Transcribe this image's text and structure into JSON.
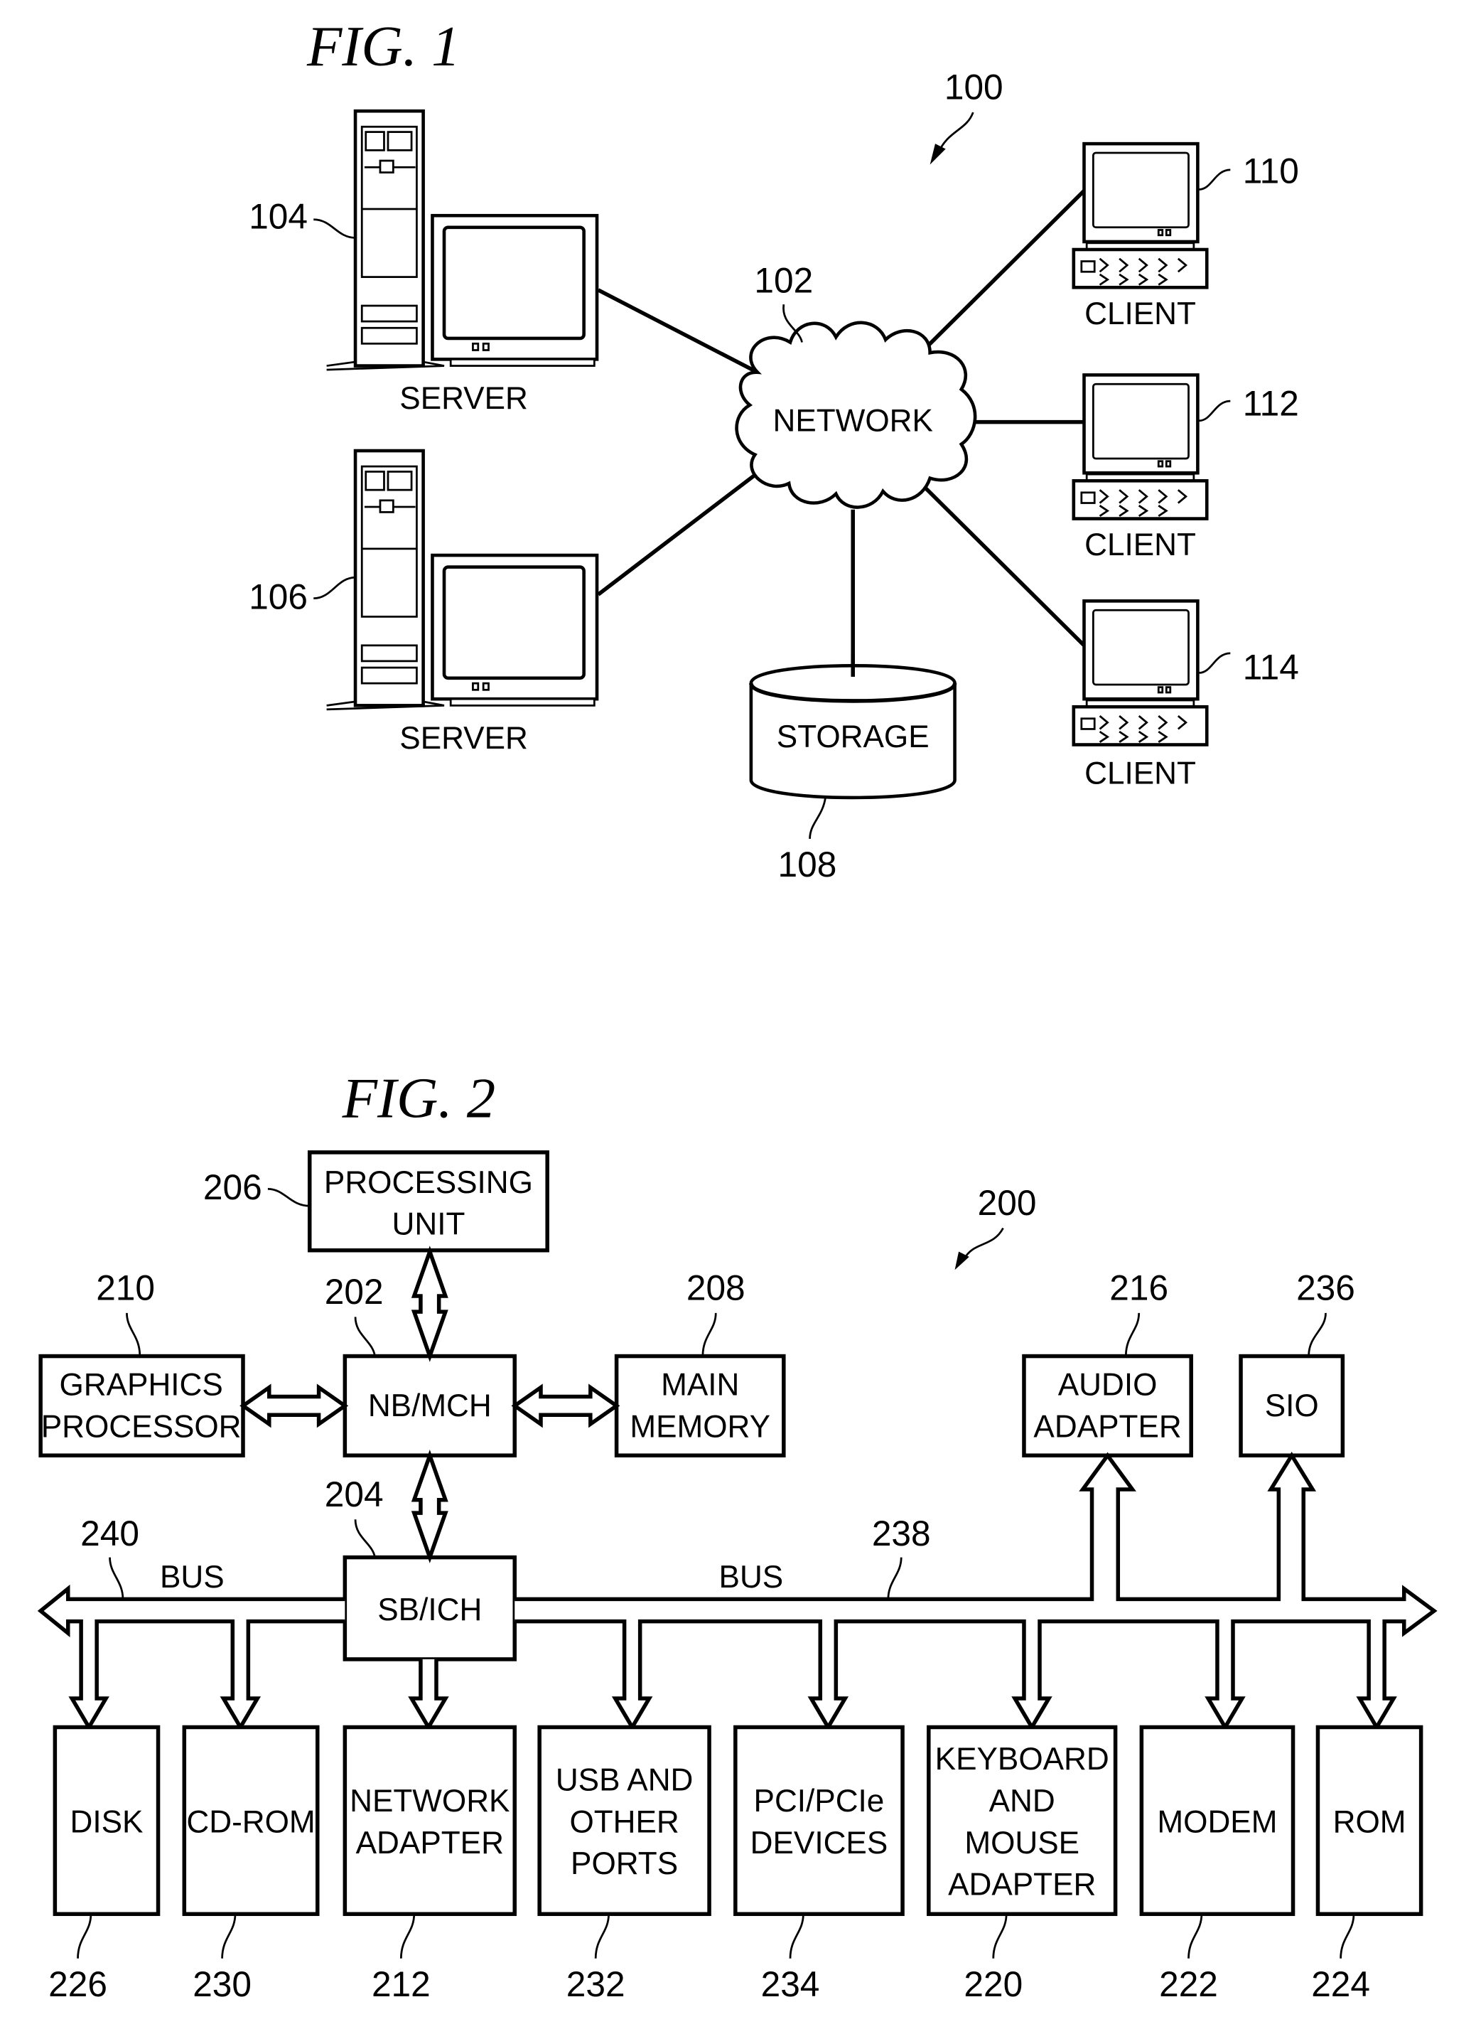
{
  "fig1": {
    "title": "FIG. 1",
    "system_ref": "100",
    "network": {
      "label": "NETWORK",
      "ref": "102"
    },
    "servers": [
      {
        "label": "SERVER",
        "ref": "104"
      },
      {
        "label": "SERVER",
        "ref": "106"
      }
    ],
    "storage": {
      "label": "STORAGE",
      "ref": "108"
    },
    "clients": [
      {
        "label": "CLIENT",
        "ref": "110"
      },
      {
        "label": "CLIENT",
        "ref": "112"
      },
      {
        "label": "CLIENT",
        "ref": "114"
      }
    ]
  },
  "fig2": {
    "title": "FIG. 2",
    "system_ref": "200",
    "processing_unit": {
      "lines": [
        "PROCESSING",
        "UNIT"
      ],
      "ref": "206"
    },
    "graphics_processor": {
      "lines": [
        "GRAPHICS",
        "PROCESSOR"
      ],
      "ref": "210"
    },
    "nb_mch": {
      "lines": [
        "NB/MCH"
      ],
      "ref": "202"
    },
    "main_memory": {
      "lines": [
        "MAIN",
        "MEMORY"
      ],
      "ref": "208"
    },
    "sb_ich": {
      "lines": [
        "SB/ICH"
      ],
      "ref": "204"
    },
    "audio_adapter": {
      "lines": [
        "AUDIO",
        "ADAPTER"
      ],
      "ref": "216"
    },
    "sio": {
      "lines": [
        "SIO"
      ],
      "ref": "236"
    },
    "bus_left": {
      "label": "BUS",
      "ref": "240"
    },
    "bus_right": {
      "label": "BUS",
      "ref": "238"
    },
    "bottom_devices": [
      {
        "lines": [
          "DISK"
        ],
        "ref": "226"
      },
      {
        "lines": [
          "CD-ROM"
        ],
        "ref": "230"
      },
      {
        "lines": [
          "NETWORK",
          "ADAPTER"
        ],
        "ref": "212"
      },
      {
        "lines": [
          "USB AND",
          "OTHER",
          "PORTS"
        ],
        "ref": "232"
      },
      {
        "lines": [
          "PCI/PCIe",
          "DEVICES"
        ],
        "ref": "234"
      },
      {
        "lines": [
          "KEYBOARD",
          "AND",
          "MOUSE",
          "ADAPTER"
        ],
        "ref": "220"
      },
      {
        "lines": [
          "MODEM"
        ],
        "ref": "222"
      },
      {
        "lines": [
          "ROM"
        ],
        "ref": "224"
      }
    ]
  }
}
